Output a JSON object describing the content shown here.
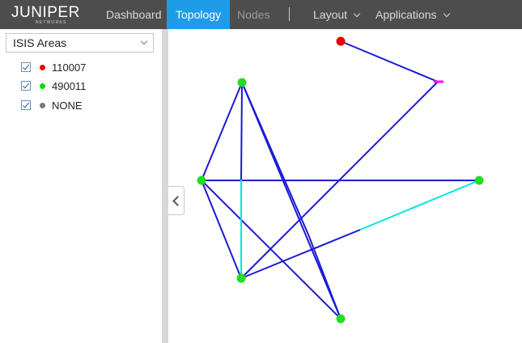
{
  "nav": {
    "logo": "JUNIPER",
    "logo_sub": "NETWORKS",
    "dashboard": "Dashboard",
    "topology": "Topology",
    "nodes": "Nodes",
    "layout": "Layout",
    "applications": "Applications"
  },
  "sidebar": {
    "select_value": "ISIS Areas",
    "legend": [
      {
        "label": "110007",
        "color": "#e60000",
        "checked": true
      },
      {
        "label": "490011",
        "color": "#00dd00",
        "checked": true
      },
      {
        "label": "NONE",
        "color": "#7a7a7a",
        "checked": true
      }
    ]
  },
  "topology": {
    "colors": {
      "link": "#1a1ad6",
      "highlight": "#00e5e5",
      "node_red": "#e60000",
      "node_green": "#22dd22",
      "magenta": "#ff00ff"
    },
    "nodes": [
      {
        "id": "n1",
        "area": "110007"
      },
      {
        "id": "n2",
        "area": "490011"
      },
      {
        "id": "n3",
        "area": "490011"
      },
      {
        "id": "n4",
        "area": "490011"
      },
      {
        "id": "n5",
        "area": "490011"
      },
      {
        "id": "n6",
        "area": "490011"
      }
    ]
  }
}
